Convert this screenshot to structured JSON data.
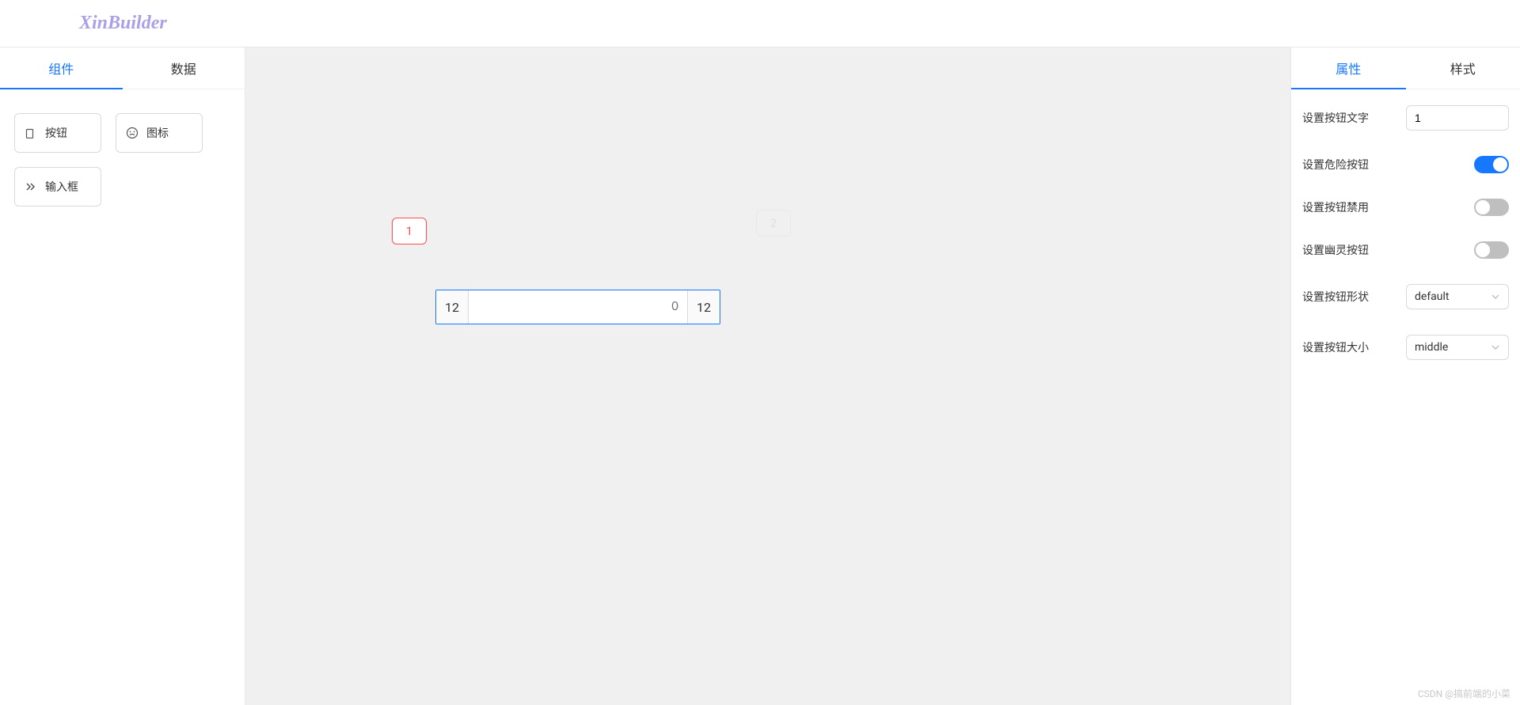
{
  "header": {
    "logo": "XinBuilder"
  },
  "left_panel": {
    "tabs": [
      {
        "label": "组件",
        "active": true
      },
      {
        "label": "数据",
        "active": false
      }
    ],
    "components": [
      {
        "name": "button-component",
        "label": "按钮",
        "icon": "rect-icon"
      },
      {
        "name": "icon-component",
        "label": "图标",
        "icon": "face-icon"
      },
      {
        "name": "input-component",
        "label": "输入框",
        "icon": "chevrons-icon"
      }
    ]
  },
  "canvas": {
    "button1": {
      "label": "1"
    },
    "button2": {
      "label": "2"
    },
    "input_group": {
      "addon_before": "12",
      "placeholder": "0",
      "addon_after": "12"
    }
  },
  "right_panel": {
    "tabs": [
      {
        "label": "属性",
        "active": true
      },
      {
        "label": "样式",
        "active": false
      }
    ],
    "properties": {
      "button_text": {
        "label": "设置按钮文字",
        "value": "1"
      },
      "danger": {
        "label": "设置危险按钮",
        "value": true
      },
      "disabled": {
        "label": "设置按钮禁用",
        "value": false
      },
      "ghost": {
        "label": "设置幽灵按钮",
        "value": false
      },
      "shape": {
        "label": "设置按钮形状",
        "value": "default"
      },
      "size": {
        "label": "设置按钮大小",
        "value": "middle"
      }
    }
  },
  "watermark": "CSDN @搞前端的小菜"
}
